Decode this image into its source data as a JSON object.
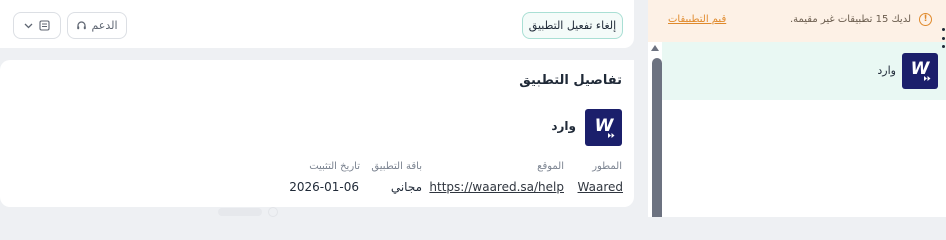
{
  "notice": {
    "text": "لديك 15 تطبيقات غير مقيمة.",
    "link_label": "قيم التطبيقات",
    "icon": "info-icon"
  },
  "sidebar": {
    "apps": [
      {
        "name": "وارد",
        "logo_letter": "W"
      }
    ]
  },
  "header": {
    "deactivate_label": "إلغاء تفعيل التطبيق",
    "support_label": "الدعم",
    "support_icon": "headset-icon",
    "menu_icon": "list-icon",
    "dropdown_icon": "chevron-down-icon"
  },
  "details": {
    "title": "تفاصيل التطبيق",
    "app_name": "وارد",
    "logo_letter": "W",
    "fields": {
      "developer": {
        "label": "المطور",
        "value": "Waared"
      },
      "website": {
        "label": "الموقع",
        "value": "https://waared.sa/help"
      },
      "plan": {
        "label": "باقة التطبيق",
        "value": "مجاني"
      },
      "install_date": {
        "label": "تاريخ التثبيت",
        "value": "2026-01-06"
      }
    }
  },
  "colors": {
    "brand_logo_bg": "#1b1f6b",
    "accent_teal": "#a9dfd4",
    "notice_bg": "#fdf1e6",
    "notice_accent": "#e08a2c",
    "selected_row_bg": "#e9f8f3"
  }
}
